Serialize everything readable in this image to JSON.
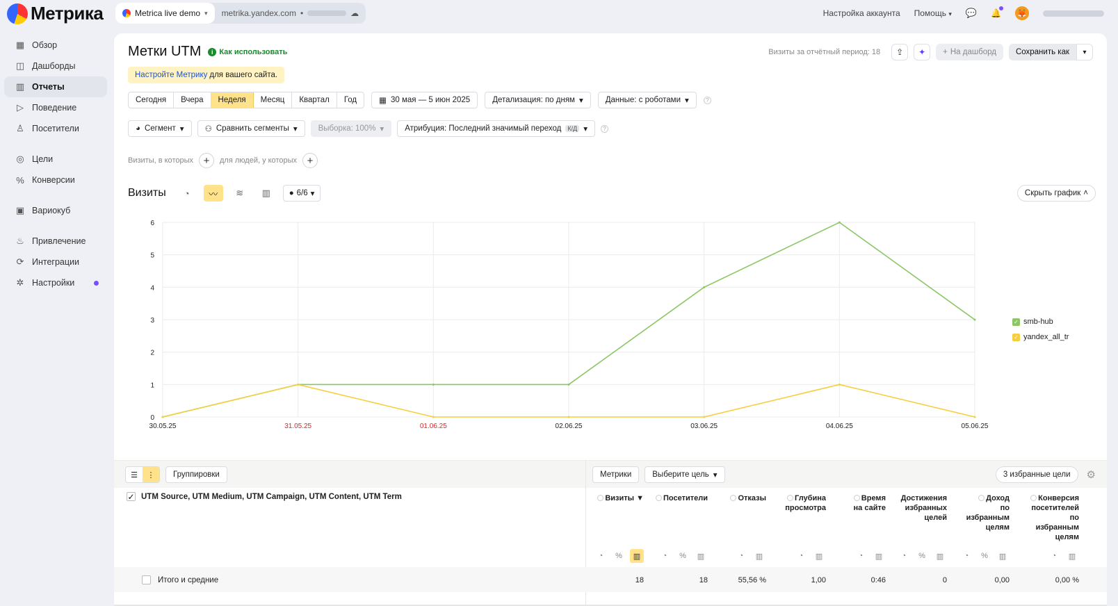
{
  "brand": {
    "name": "Метрика"
  },
  "counter": {
    "name": "Metrica live demo",
    "host": "metrika.yandex.com",
    "separator": "•"
  },
  "top_nav": {
    "account_settings": "Настройка аккаунта",
    "help": "Помощь",
    "avatar_glyph": "🦊"
  },
  "sidebar": {
    "items": [
      {
        "label": "Обзор",
        "icon": "grid-icon"
      },
      {
        "label": "Дашборды",
        "icon": "dashboard-icon"
      },
      {
        "label": "Отчеты",
        "icon": "bar-chart-icon",
        "active": true
      },
      {
        "label": "Поведение",
        "icon": "play-icon"
      },
      {
        "label": "Посетители",
        "icon": "user-icon"
      },
      {
        "label": "Цели",
        "icon": "target-icon"
      },
      {
        "label": "Конверсии",
        "icon": "percent-icon"
      },
      {
        "label": "Вариокуб",
        "icon": "cube-icon"
      },
      {
        "label": "Привлечение",
        "icon": "fire-icon"
      },
      {
        "label": "Интеграции",
        "icon": "puzzle-icon"
      },
      {
        "label": "Настройки",
        "icon": "gear-icon",
        "badge": true
      }
    ]
  },
  "page": {
    "title": "Метки UTM",
    "how_to": "Как использовать",
    "visits_period": "Визиты за отчётный период: 18",
    "to_dashboard": "На дашборд",
    "save_as": "Сохранить как",
    "warning_link": "Настройте Метрику",
    "warning_rest": "для вашего сайта."
  },
  "periods": [
    "Сегодня",
    "Вчера",
    "Неделя",
    "Месяц",
    "Квартал",
    "Год"
  ],
  "selected_period": "Неделя",
  "date_range": "30 мая — 5 июн 2025",
  "detail": "Детализация: по дням",
  "data_mode": "Данные: с роботами",
  "segment": "Сегмент",
  "compare_segments": "Сравнить сегменты",
  "sample": "Выборка: 100%",
  "attribution": "Атрибуция: Последний значимый переход",
  "attribution_badge": "К/Д",
  "filters": {
    "visits_where": "Визиты, в которых",
    "people_where": "для людей, у которых"
  },
  "chart_header": {
    "title": "Визиты",
    "series_count": "6/6",
    "hide": "Скрыть график"
  },
  "chart_data": {
    "type": "line",
    "x": [
      "30.05.25",
      "31.05.25",
      "01.06.25",
      "02.06.25",
      "03.06.25",
      "04.06.25",
      "05.06.25"
    ],
    "weekend": [
      false,
      true,
      true,
      false,
      false,
      false,
      false
    ],
    "ylim": [
      0,
      6
    ],
    "yticks": [
      0,
      1,
      2,
      3,
      4,
      5,
      6
    ],
    "grid": true,
    "legend": "right",
    "series": [
      {
        "name": "smb-hub",
        "color": "#8cc665",
        "values": [
          0,
          1,
          1,
          1,
          4,
          6,
          3
        ]
      },
      {
        "name": "yandex_all_tr",
        "color": "#f5cf3f",
        "values": [
          0,
          1,
          0,
          0,
          0,
          1,
          0
        ]
      }
    ]
  },
  "table_bar": {
    "groupings": "Группировки",
    "metrics": "Метрики",
    "choose_goal": "Выберите цель",
    "fav_goals": "3 избранные цели"
  },
  "table": {
    "dimension_header": "UTM Source, UTM Medium, UTM Campaign, UTM Content, UTM Term",
    "columns": [
      {
        "lines": [
          "Визиты ▼"
        ]
      },
      {
        "lines": [
          "Посетители"
        ]
      },
      {
        "lines": [
          "Отказы"
        ]
      },
      {
        "lines": [
          "Глубина",
          "просмотра"
        ]
      },
      {
        "lines": [
          "Время",
          "на сайте"
        ]
      },
      {
        "lines": [
          "Достижения",
          "избранных",
          "целей"
        ]
      },
      {
        "lines": [
          "Доход",
          "по",
          "избранным",
          "целям"
        ]
      },
      {
        "lines": [
          "Конверсия",
          "посетителей",
          "по",
          "избранным",
          "целям"
        ]
      }
    ],
    "total_label": "Итого и средние",
    "totals": [
      "18",
      "18",
      "55,56 %",
      "1,00",
      "0:46",
      "0",
      "0,00",
      "0,00 %"
    ]
  }
}
